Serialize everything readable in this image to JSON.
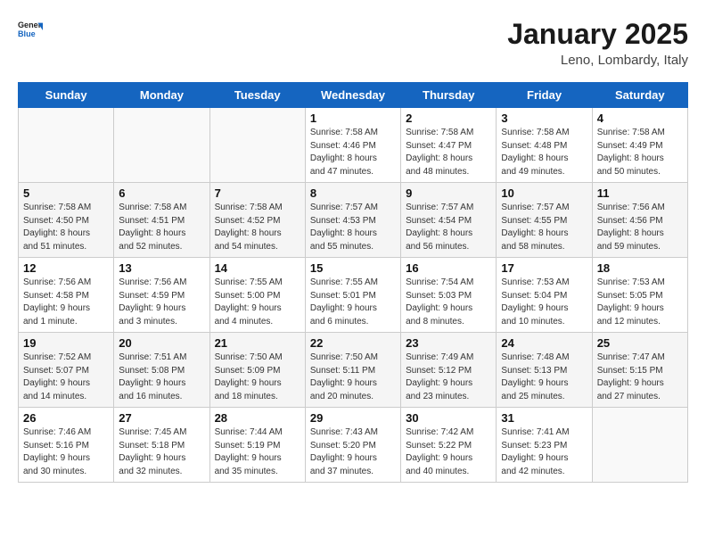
{
  "logo": {
    "line1": "General",
    "line2": "Blue"
  },
  "title": "January 2025",
  "subtitle": "Leno, Lombardy, Italy",
  "days_header": [
    "Sunday",
    "Monday",
    "Tuesday",
    "Wednesday",
    "Thursday",
    "Friday",
    "Saturday"
  ],
  "weeks": [
    [
      {
        "day": "",
        "info": ""
      },
      {
        "day": "",
        "info": ""
      },
      {
        "day": "",
        "info": ""
      },
      {
        "day": "1",
        "info": "Sunrise: 7:58 AM\nSunset: 4:46 PM\nDaylight: 8 hours\nand 47 minutes."
      },
      {
        "day": "2",
        "info": "Sunrise: 7:58 AM\nSunset: 4:47 PM\nDaylight: 8 hours\nand 48 minutes."
      },
      {
        "day": "3",
        "info": "Sunrise: 7:58 AM\nSunset: 4:48 PM\nDaylight: 8 hours\nand 49 minutes."
      },
      {
        "day": "4",
        "info": "Sunrise: 7:58 AM\nSunset: 4:49 PM\nDaylight: 8 hours\nand 50 minutes."
      }
    ],
    [
      {
        "day": "5",
        "info": "Sunrise: 7:58 AM\nSunset: 4:50 PM\nDaylight: 8 hours\nand 51 minutes."
      },
      {
        "day": "6",
        "info": "Sunrise: 7:58 AM\nSunset: 4:51 PM\nDaylight: 8 hours\nand 52 minutes."
      },
      {
        "day": "7",
        "info": "Sunrise: 7:58 AM\nSunset: 4:52 PM\nDaylight: 8 hours\nand 54 minutes."
      },
      {
        "day": "8",
        "info": "Sunrise: 7:57 AM\nSunset: 4:53 PM\nDaylight: 8 hours\nand 55 minutes."
      },
      {
        "day": "9",
        "info": "Sunrise: 7:57 AM\nSunset: 4:54 PM\nDaylight: 8 hours\nand 56 minutes."
      },
      {
        "day": "10",
        "info": "Sunrise: 7:57 AM\nSunset: 4:55 PM\nDaylight: 8 hours\nand 58 minutes."
      },
      {
        "day": "11",
        "info": "Sunrise: 7:56 AM\nSunset: 4:56 PM\nDaylight: 8 hours\nand 59 minutes."
      }
    ],
    [
      {
        "day": "12",
        "info": "Sunrise: 7:56 AM\nSunset: 4:58 PM\nDaylight: 9 hours\nand 1 minute."
      },
      {
        "day": "13",
        "info": "Sunrise: 7:56 AM\nSunset: 4:59 PM\nDaylight: 9 hours\nand 3 minutes."
      },
      {
        "day": "14",
        "info": "Sunrise: 7:55 AM\nSunset: 5:00 PM\nDaylight: 9 hours\nand 4 minutes."
      },
      {
        "day": "15",
        "info": "Sunrise: 7:55 AM\nSunset: 5:01 PM\nDaylight: 9 hours\nand 6 minutes."
      },
      {
        "day": "16",
        "info": "Sunrise: 7:54 AM\nSunset: 5:03 PM\nDaylight: 9 hours\nand 8 minutes."
      },
      {
        "day": "17",
        "info": "Sunrise: 7:53 AM\nSunset: 5:04 PM\nDaylight: 9 hours\nand 10 minutes."
      },
      {
        "day": "18",
        "info": "Sunrise: 7:53 AM\nSunset: 5:05 PM\nDaylight: 9 hours\nand 12 minutes."
      }
    ],
    [
      {
        "day": "19",
        "info": "Sunrise: 7:52 AM\nSunset: 5:07 PM\nDaylight: 9 hours\nand 14 minutes."
      },
      {
        "day": "20",
        "info": "Sunrise: 7:51 AM\nSunset: 5:08 PM\nDaylight: 9 hours\nand 16 minutes."
      },
      {
        "day": "21",
        "info": "Sunrise: 7:50 AM\nSunset: 5:09 PM\nDaylight: 9 hours\nand 18 minutes."
      },
      {
        "day": "22",
        "info": "Sunrise: 7:50 AM\nSunset: 5:11 PM\nDaylight: 9 hours\nand 20 minutes."
      },
      {
        "day": "23",
        "info": "Sunrise: 7:49 AM\nSunset: 5:12 PM\nDaylight: 9 hours\nand 23 minutes."
      },
      {
        "day": "24",
        "info": "Sunrise: 7:48 AM\nSunset: 5:13 PM\nDaylight: 9 hours\nand 25 minutes."
      },
      {
        "day": "25",
        "info": "Sunrise: 7:47 AM\nSunset: 5:15 PM\nDaylight: 9 hours\nand 27 minutes."
      }
    ],
    [
      {
        "day": "26",
        "info": "Sunrise: 7:46 AM\nSunset: 5:16 PM\nDaylight: 9 hours\nand 30 minutes."
      },
      {
        "day": "27",
        "info": "Sunrise: 7:45 AM\nSunset: 5:18 PM\nDaylight: 9 hours\nand 32 minutes."
      },
      {
        "day": "28",
        "info": "Sunrise: 7:44 AM\nSunset: 5:19 PM\nDaylight: 9 hours\nand 35 minutes."
      },
      {
        "day": "29",
        "info": "Sunrise: 7:43 AM\nSunset: 5:20 PM\nDaylight: 9 hours\nand 37 minutes."
      },
      {
        "day": "30",
        "info": "Sunrise: 7:42 AM\nSunset: 5:22 PM\nDaylight: 9 hours\nand 40 minutes."
      },
      {
        "day": "31",
        "info": "Sunrise: 7:41 AM\nSunset: 5:23 PM\nDaylight: 9 hours\nand 42 minutes."
      },
      {
        "day": "",
        "info": ""
      }
    ]
  ]
}
